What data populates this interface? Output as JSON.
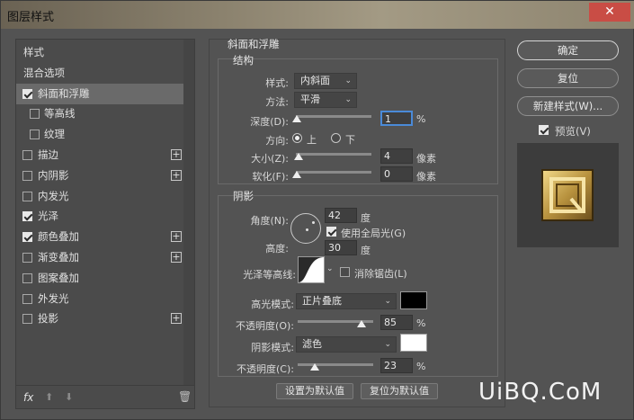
{
  "window": {
    "title": "图层样式",
    "close": "✕"
  },
  "left_panel": {
    "items": [
      {
        "label": "样式",
        "checkbox": false,
        "checked": false,
        "plus": false,
        "selected": false,
        "sub": false
      },
      {
        "label": "混合选项",
        "checkbox": false,
        "checked": false,
        "plus": false,
        "selected": false,
        "sub": false
      },
      {
        "label": "斜面和浮雕",
        "checkbox": true,
        "checked": true,
        "plus": false,
        "selected": true,
        "sub": false
      },
      {
        "label": "等高线",
        "checkbox": true,
        "checked": false,
        "plus": false,
        "selected": false,
        "sub": true
      },
      {
        "label": "纹理",
        "checkbox": true,
        "checked": false,
        "plus": false,
        "selected": false,
        "sub": true
      },
      {
        "label": "描边",
        "checkbox": true,
        "checked": false,
        "plus": true,
        "selected": false,
        "sub": false
      },
      {
        "label": "内阴影",
        "checkbox": true,
        "checked": false,
        "plus": true,
        "selected": false,
        "sub": false
      },
      {
        "label": "内发光",
        "checkbox": true,
        "checked": false,
        "plus": false,
        "selected": false,
        "sub": false
      },
      {
        "label": "光泽",
        "checkbox": true,
        "checked": true,
        "plus": false,
        "selected": false,
        "sub": false
      },
      {
        "label": "颜色叠加",
        "checkbox": true,
        "checked": true,
        "plus": true,
        "selected": false,
        "sub": false
      },
      {
        "label": "渐变叠加",
        "checkbox": true,
        "checked": false,
        "plus": true,
        "selected": false,
        "sub": false
      },
      {
        "label": "图案叠加",
        "checkbox": true,
        "checked": false,
        "plus": false,
        "selected": false,
        "sub": false
      },
      {
        "label": "外发光",
        "checkbox": true,
        "checked": false,
        "plus": false,
        "selected": false,
        "sub": false
      },
      {
        "label": "投影",
        "checkbox": true,
        "checked": false,
        "plus": true,
        "selected": false,
        "sub": false
      }
    ],
    "fx_label": "fx",
    "plus_glyph": "+"
  },
  "bevel": {
    "section_title": "斜面和浮雕",
    "structure_title": "结构",
    "style_label": "样式:",
    "style_value": "内斜面",
    "technique_label": "方法:",
    "technique_value": "平滑",
    "depth_label": "深度(D):",
    "depth_value": "1",
    "depth_unit": "%",
    "direction_label": "方向:",
    "direction_up": "上",
    "direction_down": "下",
    "size_label": "大小(Z):",
    "size_value": "4",
    "size_unit": "像素",
    "soften_label": "软化(F):",
    "soften_value": "0",
    "soften_unit": "像素"
  },
  "shading": {
    "title": "阴影",
    "angle_label": "角度(N):",
    "angle_value": "42",
    "angle_unit": "度",
    "global_light_label": "使用全局光(G)",
    "altitude_label": "高度:",
    "altitude_value": "30",
    "altitude_unit": "度",
    "gloss_contour_label": "光泽等高线:",
    "anti_alias_label": "消除锯齿(L)",
    "highlight_mode_label": "高光模式:",
    "highlight_mode_value": "正片叠底",
    "highlight_color": "#000000",
    "highlight_opacity_label": "不透明度(O):",
    "highlight_opacity_value": "85",
    "highlight_opacity_unit": "%",
    "shadow_mode_label": "阴影模式:",
    "shadow_mode_value": "滤色",
    "shadow_color": "#ffffff",
    "shadow_opacity_label": "不透明度(C):",
    "shadow_opacity_value": "23",
    "shadow_opacity_unit": "%"
  },
  "footer": {
    "make_default": "设置为默认值",
    "reset_default": "复位为默认值"
  },
  "right_panel": {
    "ok": "确定",
    "reset": "复位",
    "new_style": "新建样式(W)...",
    "preview_label": "预览(V)"
  },
  "watermark": "UiBQ.CoM"
}
